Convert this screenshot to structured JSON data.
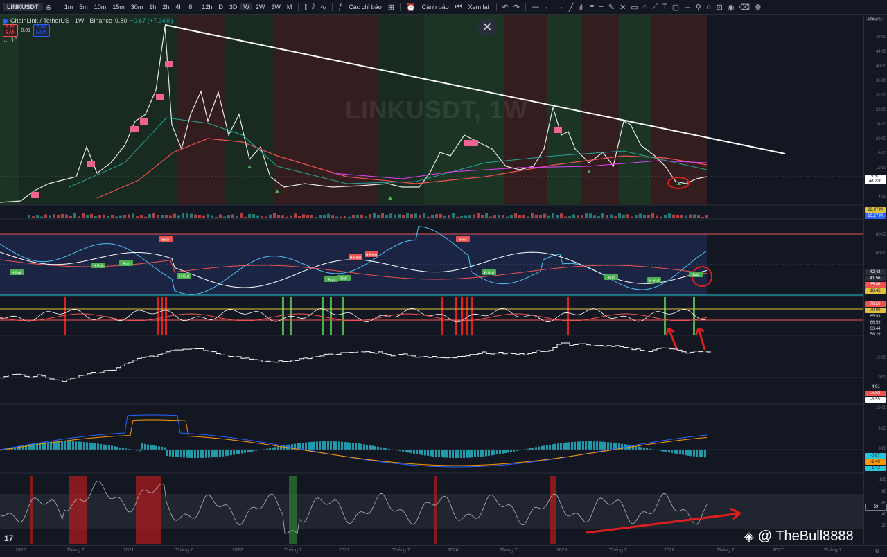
{
  "toolbar": {
    "symbol": "LINKUSDT",
    "timeframes": [
      "1m",
      "5m",
      "10m",
      "15m",
      "30m",
      "1h",
      "2h",
      "4h",
      "8h",
      "12h",
      "D",
      "3D",
      "W",
      "2W",
      "3W",
      "M"
    ],
    "active_timeframe": "W",
    "indicators_label": "Các chỉ báo",
    "alerts_label": "Cảnh báo",
    "replay_label": "Xem lại"
  },
  "legend": {
    "title": "ChainLink / TetherUS · 1W · Binance",
    "price": "9.80",
    "change": "+0.67 (+7.34%)",
    "sell_price": "9.80",
    "sell_label": "BÁN",
    "spread": "0.01",
    "buy_price": "9.81",
    "buy_label": "MUA",
    "volume_label": "10"
  },
  "watermark": "LINKUSDT, 1W",
  "price_axis": {
    "currency": "USDT",
    "labels": [
      "48.00",
      "44.00",
      "40.00",
      "36.00",
      "32.00",
      "28.00",
      "24.00",
      "20.00",
      "16.00",
      "12.00",
      "8.00",
      "4.00"
    ],
    "last_price": "9.80",
    "countdown": "4d 22h"
  },
  "volume_axis": {
    "vol1": "22.07 M",
    "vol2": "10.27 M"
  },
  "rsi_axis": {
    "labels": [
      "80.00",
      "60.00"
    ],
    "values": [
      "42.43",
      "41.56",
      "35.46",
      "18.45"
    ]
  },
  "osc_axis": {
    "values": [
      "76.26",
      "70.00",
      "65.93",
      "66.59",
      "63.44",
      "58.29"
    ]
  },
  "step_axis": {
    "labels": [
      "10.00",
      "0.00"
    ],
    "values": [
      "-4.91",
      "-5.80",
      "-6.55"
    ]
  },
  "macd_axis": {
    "labels": [
      "16.00",
      "8.00",
      "0.00"
    ],
    "values": [
      "-0.87",
      "-1.40",
      "-1.43"
    ]
  },
  "bottom_axis": {
    "labels": [
      "100",
      "80",
      "60",
      "40",
      "20"
    ],
    "value": "59"
  },
  "time_axis": [
    "2020",
    "Tháng 7",
    "2021",
    "Tháng 7",
    "2022",
    "Tháng 7",
    "2023",
    "Tháng 7",
    "2024",
    "Tháng 7",
    "2025",
    "Tháng 7",
    "2026",
    "Tháng 7",
    "2027",
    "Tháng 7"
  ],
  "signal_labels": {
    "bear": [
      "Bear",
      "Bear",
      "H Bear",
      "H Bear"
    ],
    "bull": [
      "H Bull",
      "H Bull",
      "Bull",
      "H Bull",
      "Bull",
      "Bull",
      "H Bull",
      "Bull",
      "H Bull",
      "Bull"
    ]
  },
  "credit": "@ TheBull8888",
  "colors": {
    "up": "#26a69a",
    "down": "#ef5350",
    "accent": "#2962ff",
    "trendline": "#ffffff"
  }
}
